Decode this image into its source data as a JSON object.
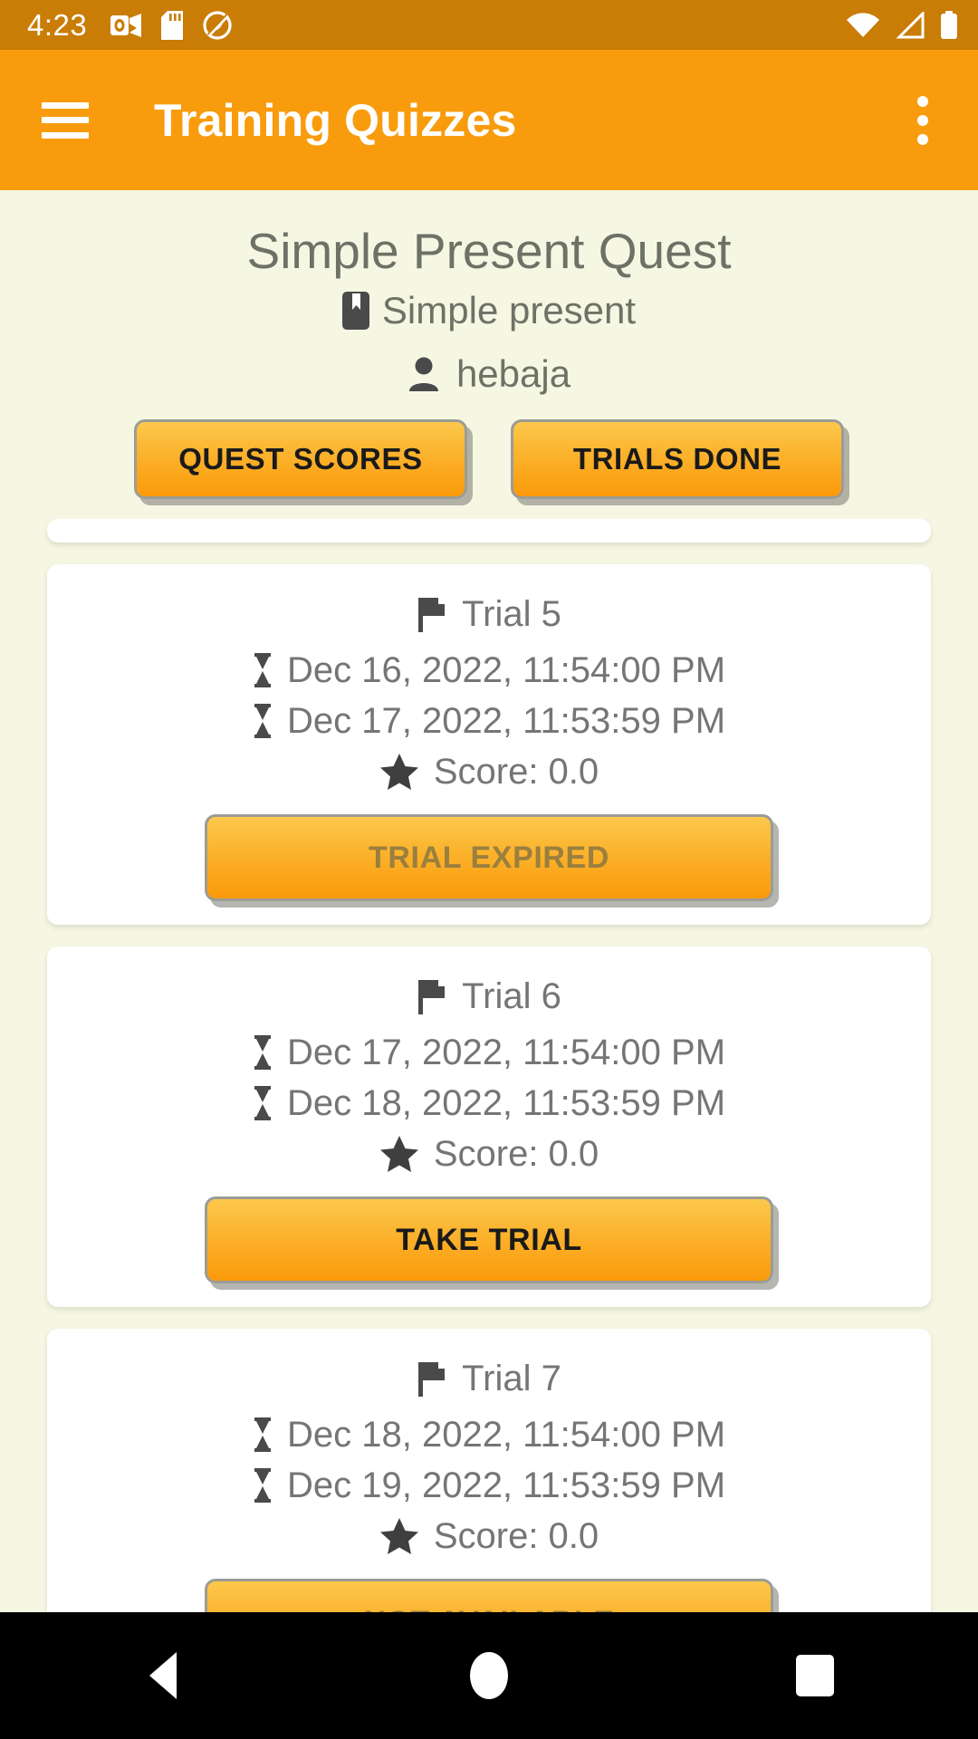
{
  "status_bar": {
    "clock": "4:23",
    "background_color": "#C97C06",
    "notification_icons": [
      "outlook-icon",
      "sd-card-icon",
      "do-not-disturb-icon"
    ],
    "system_icons": [
      "wifi-icon",
      "cellular-signal-icon",
      "battery-icon"
    ]
  },
  "app_bar": {
    "title": "Training Quizzes",
    "background_color": "#F89C0E",
    "menu_icon": "hamburger-menu-icon",
    "overflow_icon": "more-vert-icon"
  },
  "header": {
    "quest_title": "Simple Present Quest",
    "subject_icon": "bookmark-icon",
    "subject": "Simple present",
    "user_icon": "person-icon",
    "username": "hebaja",
    "buttons": [
      {
        "label": "QUEST SCORES",
        "name": "quest-scores-button"
      },
      {
        "label": "TRIALS DONE",
        "name": "trials-done-button"
      }
    ]
  },
  "trials": [
    {
      "title": "Trial 5",
      "start": "Dec 16, 2022, 11:54:00 PM",
      "end": "Dec 17, 2022, 11:53:59 PM",
      "score": "Score: 0.0",
      "action_label": "TRIAL EXPIRED",
      "action_state": "disabled"
    },
    {
      "title": "Trial 6",
      "start": "Dec 17, 2022, 11:54:00 PM",
      "end": "Dec 18, 2022, 11:53:59 PM",
      "score": "Score: 0.0",
      "action_label": "TAKE TRIAL",
      "action_state": "enabled"
    },
    {
      "title": "Trial 7",
      "start": "Dec 18, 2022, 11:54:00 PM",
      "end": "Dec 19, 2022, 11:53:59 PM",
      "score": "Score: 0.0",
      "action_label": "NOT AVAILABLE",
      "action_state": "disabled"
    }
  ],
  "icons": {
    "trial_title": "flag-icon",
    "date": "hourglass-icon",
    "score": "star-icon"
  },
  "nav_bar": {
    "back": "back-triangle-icon",
    "home": "home-circle-icon",
    "recents": "recents-square-icon"
  },
  "colors": {
    "page_background": "#F6F7E3",
    "card_background": "#FFFFFF",
    "accent_orange": "#F89C0E",
    "status_orange": "#C97C06",
    "text_gray": "#757575",
    "heading_gray": "#6E7266",
    "disabled_button_text": "#9A7F3E"
  }
}
